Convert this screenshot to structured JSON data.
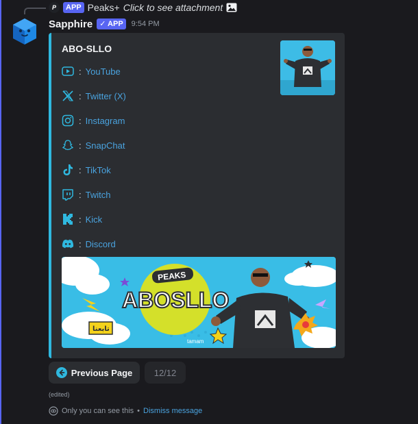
{
  "reply": {
    "avatar_letter": "P",
    "tag": "APP",
    "name": "Peaks+",
    "text": "Click to see attachment"
  },
  "message": {
    "username": "Sapphire",
    "app_tag": "✓ APP",
    "timestamp": "9:54 PM"
  },
  "embed": {
    "accent_color": "#2fb8df",
    "title": "ABO-SLLO",
    "links": [
      {
        "icon": "youtube-icon",
        "sep": ":",
        "label": "YouTube"
      },
      {
        "icon": "twitter-x-icon",
        "sep": ":",
        "label": "Twitter (X)"
      },
      {
        "icon": "instagram-icon",
        "sep": ":",
        "label": "Instagram"
      },
      {
        "icon": "snapchat-icon",
        "sep": ":",
        "label": "SnapChat"
      },
      {
        "icon": "tiktok-icon",
        "sep": ":",
        "label": "TikTok"
      },
      {
        "icon": "twitch-icon",
        "sep": ":",
        "label": "Twitch"
      },
      {
        "icon": "kick-icon",
        "sep": ":",
        "label": "Kick"
      },
      {
        "icon": "discord-icon",
        "sep": ":",
        "label": "Discord"
      }
    ],
    "banner": {
      "badge": "PEAKS",
      "name": "ABOSLLO",
      "arabic": "تابعنا",
      "brand": "tamam"
    }
  },
  "buttons": {
    "previous": "Previous Page",
    "page": "12/12"
  },
  "footer": {
    "edited": "(edited)",
    "only_you": "Only you can see this",
    "bullet": "•",
    "dismiss": "Dismiss message"
  }
}
